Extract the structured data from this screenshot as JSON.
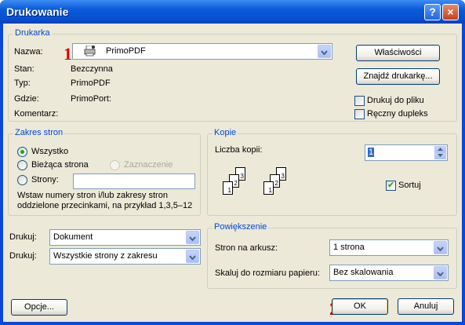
{
  "window": {
    "title": "Drukowanie",
    "help_label": "?",
    "close_label": "×"
  },
  "printer": {
    "group_title": "Drukarka",
    "name_label": "Nazwa:",
    "name_value": "PrimoPDF",
    "status_label": "Stan:",
    "status_value": "Bezczynna",
    "type_label": "Typ:",
    "type_value": "PrimoPDF",
    "where_label": "Gdzie:",
    "where_value": "PrimoPort:",
    "comment_label": "Komentarz:",
    "comment_value": "",
    "properties_button": "Właściwości",
    "find_printer_button": "Znajdź drukarkę...",
    "print_to_file_label": "Drukuj do pliku",
    "print_to_file_checked": false,
    "manual_duplex_label": "Ręczny dupleks",
    "manual_duplex_checked": false
  },
  "page_range": {
    "group_title": "Zakres stron",
    "all_label": "Wszystko",
    "current_label": "Bieżąca strona",
    "selection_label": "Zaznaczenie",
    "pages_label": "Strony:",
    "pages_value": "",
    "selected": "all",
    "hint": "Wstaw numery stron i/lub zakresy stron oddzielone przecinkami, na przykład 1,3,5–12"
  },
  "copies": {
    "group_title": "Kopie",
    "count_label": "Liczba kopii:",
    "count_value": "1",
    "collate_label": "Sortuj",
    "collate_checked": true,
    "page_numbers": [
      "1",
      "2",
      "3"
    ]
  },
  "print_what": {
    "label": "Drukuj:",
    "value": "Dokument"
  },
  "print_pages": {
    "label": "Drukuj:",
    "value": "Wszystkie strony z zakresu"
  },
  "zoom": {
    "group_title": "Powiększenie",
    "pages_per_sheet_label": "Stron na arkusz:",
    "pages_per_sheet_value": "1 strona",
    "scale_label": "Skaluj do rozmiaru papieru:",
    "scale_value": "Bez skalowania"
  },
  "footer": {
    "options_button": "Opcje...",
    "ok_button": "OK",
    "cancel_button": "Anuluj"
  },
  "annotations": {
    "marker_1": "1",
    "marker_2": "2"
  }
}
